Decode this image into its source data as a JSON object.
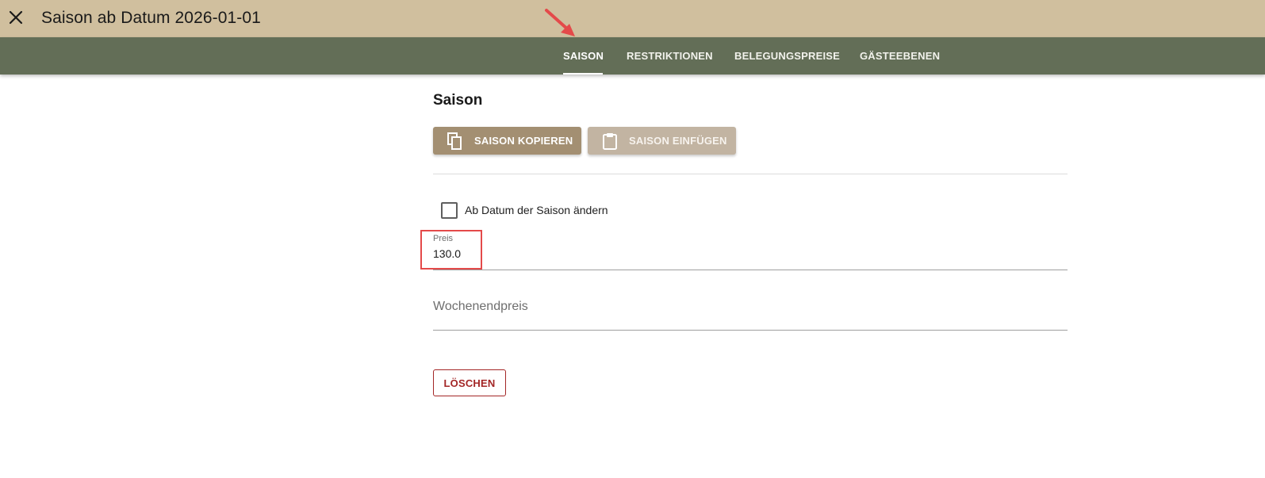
{
  "header": {
    "title": "Saison ab Datum 2026-01-01",
    "close_icon": "close-icon"
  },
  "tabs": [
    {
      "label": "SAISON",
      "active": true
    },
    {
      "label": "RESTRIKTIONEN",
      "active": false
    },
    {
      "label": "BELEGUNGSPREISE",
      "active": false
    },
    {
      "label": "GÄSTEEBENEN",
      "active": false
    }
  ],
  "section": {
    "title": "Saison",
    "copy_button": {
      "label": "SAISON KOPIEREN",
      "icon": "copy-icon"
    },
    "paste_button": {
      "label": "SAISON EINFÜGEN",
      "icon": "clipboard-icon"
    },
    "checkbox": {
      "label": "Ab Datum der Saison ändern",
      "checked": false
    },
    "price_field": {
      "label": "Preis",
      "value": "130.0"
    },
    "weekend_price_field": {
      "placeholder": "Wochenendpreis",
      "value": ""
    },
    "delete_button": {
      "label": "LÖSCHEN"
    }
  },
  "colors": {
    "topbar": "#d0bf9e",
    "tabbar": "#636e57",
    "copy_button": "#a38f72",
    "paste_button": "#c2b4a2",
    "delete": "#a32626",
    "annotation": "#e44a4a"
  }
}
